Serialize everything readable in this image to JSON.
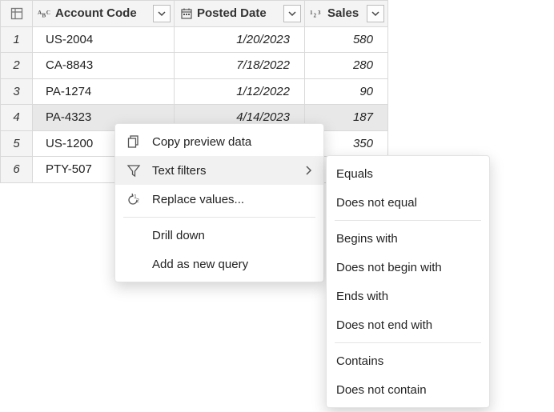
{
  "columns": {
    "account": {
      "label": "Account Code",
      "type_icon": "abc"
    },
    "posted": {
      "label": "Posted Date",
      "type_icon": "calendar"
    },
    "sales": {
      "label": "Sales",
      "type_icon": "123"
    }
  },
  "rows": [
    {
      "n": "1",
      "account": "US-2004",
      "posted": "1/20/2023",
      "sales": "580"
    },
    {
      "n": "2",
      "account": "CA-8843",
      "posted": "7/18/2022",
      "sales": "280"
    },
    {
      "n": "3",
      "account": "PA-1274",
      "posted": "1/12/2022",
      "sales": "90"
    },
    {
      "n": "4",
      "account": "PA-4323",
      "posted": "4/14/2023",
      "sales": "187"
    },
    {
      "n": "5",
      "account": "US-1200",
      "posted": "",
      "sales": "350"
    },
    {
      "n": "6",
      "account": "PTY-507",
      "posted": "",
      "sales": ""
    }
  ],
  "context_menu": {
    "copy": "Copy preview data",
    "filters": "Text filters",
    "replace": "Replace values...",
    "drill": "Drill down",
    "addnew": "Add as new query"
  },
  "text_filters_submenu": {
    "equals": "Equals",
    "not_equal": "Does not equal",
    "begins": "Begins with",
    "not_begin": "Does not begin with",
    "ends": "Ends with",
    "not_end": "Does not end with",
    "contains": "Contains",
    "not_contain": "Does not contain"
  }
}
